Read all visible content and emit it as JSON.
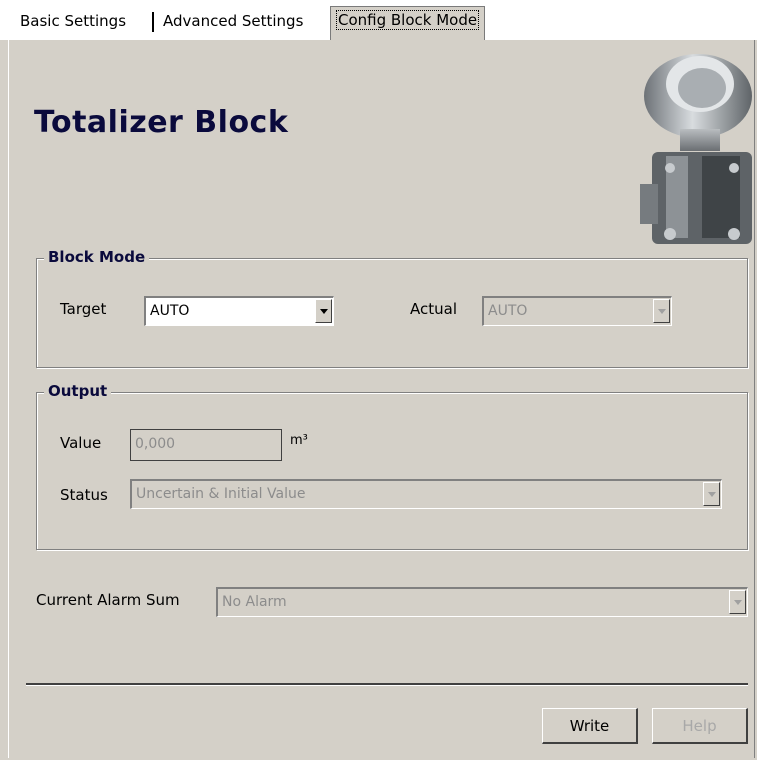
{
  "tabs": [
    {
      "label": "Basic Settings"
    },
    {
      "label": "Advanced Settings"
    },
    {
      "label": "Config Block Mode",
      "active": true
    }
  ],
  "page_title": "Totalizer Block",
  "block_mode": {
    "group_label": "Block Mode",
    "target_label": "Target",
    "target_value": "AUTO",
    "actual_label": "Actual",
    "actual_value": "AUTO"
  },
  "output": {
    "group_label": "Output",
    "value_label": "Value",
    "value": "0,000",
    "unit": "m³",
    "status_label": "Status",
    "status_value": "Uncertain & Initial Value"
  },
  "alarm": {
    "label": "Current Alarm Sum",
    "value": "No Alarm"
  },
  "buttons": {
    "write": "Write",
    "help": "Help"
  },
  "colors": {
    "background": "#d4d0c8",
    "title": "#0a0a3c",
    "disabled_text": "#8c8c8c"
  }
}
